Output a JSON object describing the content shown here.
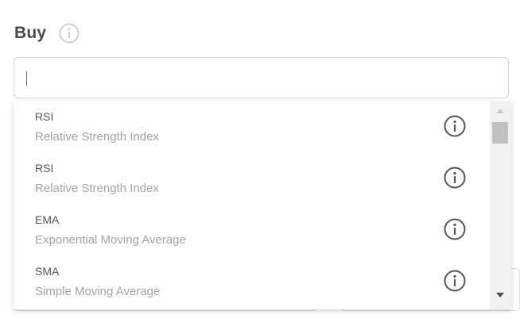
{
  "form": {
    "title": "Buy",
    "title_info_icon": "info-circle-icon"
  },
  "search": {
    "value": "",
    "placeholder": ""
  },
  "dropdown": {
    "items": [
      {
        "code": "RSI",
        "description": "Relative Strength Index",
        "icon": "info-circle-icon"
      },
      {
        "code": "RSI",
        "description": "Relative Strength Index",
        "icon": "info-circle-icon"
      },
      {
        "code": "EMA",
        "description": "Exponential Moving Average",
        "icon": "info-circle-icon"
      },
      {
        "code": "SMA",
        "description": "Simple Moving Average",
        "icon": "info-circle-icon"
      }
    ]
  },
  "colors": {
    "title": "#4a4a4a",
    "code_text": "#555555",
    "desc_text": "#a3a3a3",
    "border": "#d6d6d6"
  }
}
